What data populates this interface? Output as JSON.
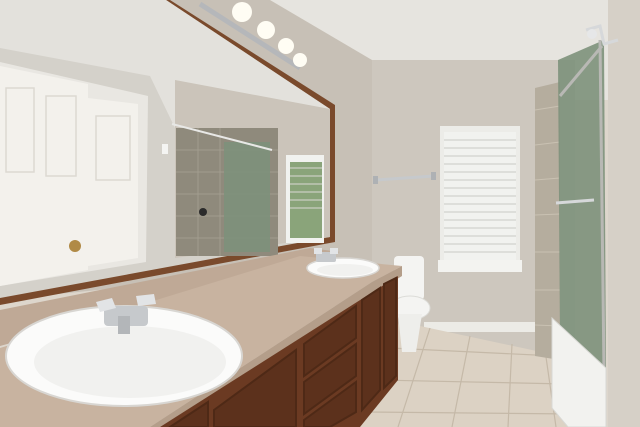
{
  "scene": {
    "colors": {
      "ceiling": "#e6e4df",
      "wall": "#cdc7be",
      "wall_shadow": "#bdb6ac",
      "mirror_frame": "#7a4a2c",
      "mirror_glass": "#d4d1ca",
      "door": "#f3f1ec",
      "shower_tile": "#8f8a7c",
      "shower_glass": "#7d917b",
      "window_light": "#f1f2ef",
      "blind_line": "#c9c9c4",
      "countertop": "#c8b3a0",
      "sink": "#fbfbfa",
      "cabinet": "#6b3a22",
      "cabinet_dark": "#4e2916",
      "floor_tile": "#dcd2c4",
      "grout": "#c5b9a8",
      "toilet": "#f4f4f2",
      "tub": "#f2f2ef",
      "enclosure_frame": "#b8b8b4",
      "chrome": "#c6c9cc",
      "door_knob": "#b08a46"
    }
  }
}
